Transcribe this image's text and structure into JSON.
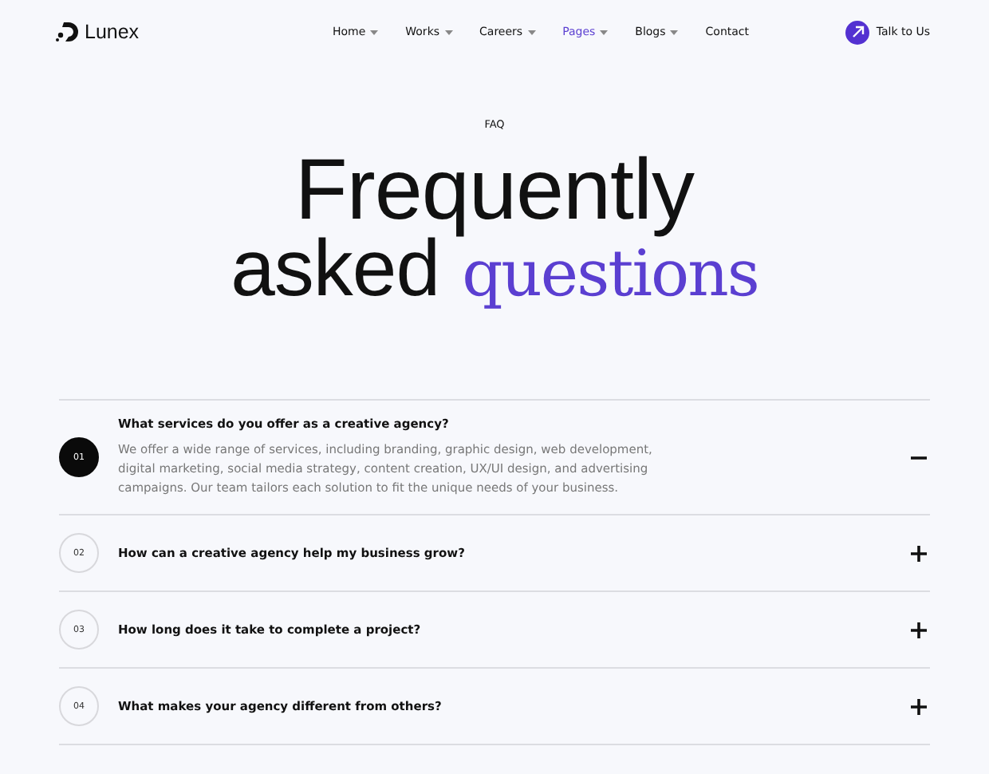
{
  "logo": {
    "text": "Lunex"
  },
  "nav": [
    {
      "label": "Home",
      "dropdown": true,
      "selected": false
    },
    {
      "label": "Works",
      "dropdown": true,
      "selected": false
    },
    {
      "label": "Careers",
      "dropdown": true,
      "selected": false
    },
    {
      "label": "Pages",
      "dropdown": true,
      "selected": true
    },
    {
      "label": "Blogs",
      "dropdown": true,
      "selected": false
    },
    {
      "label": "Contact",
      "dropdown": false,
      "selected": false
    }
  ],
  "cta": {
    "label": "Talk to Us"
  },
  "eyebrow": "FAQ",
  "heading": {
    "line1": "Frequently",
    "line2": [
      {
        "text": "asked",
        "accent": false
      },
      {
        "text": "questions",
        "accent": true
      }
    ]
  },
  "faqs": [
    {
      "number": "01",
      "question": "What services do you offer as a creative agency?",
      "answer": "We offer a wide range of services, including branding, graphic design, web development, digital marketing, social media strategy, content creation, UX/UI design, and advertising campaigns. Our team tailors each solution to fit the unique needs of your business.",
      "expanded": true
    },
    {
      "number": "02",
      "question": "How can a creative agency help my business grow?",
      "expanded": false
    },
    {
      "number": "03",
      "question": "How long does it take to complete a project?",
      "expanded": false
    },
    {
      "number": "04",
      "question": "What makes your agency different from others?",
      "expanded": false
    }
  ]
}
